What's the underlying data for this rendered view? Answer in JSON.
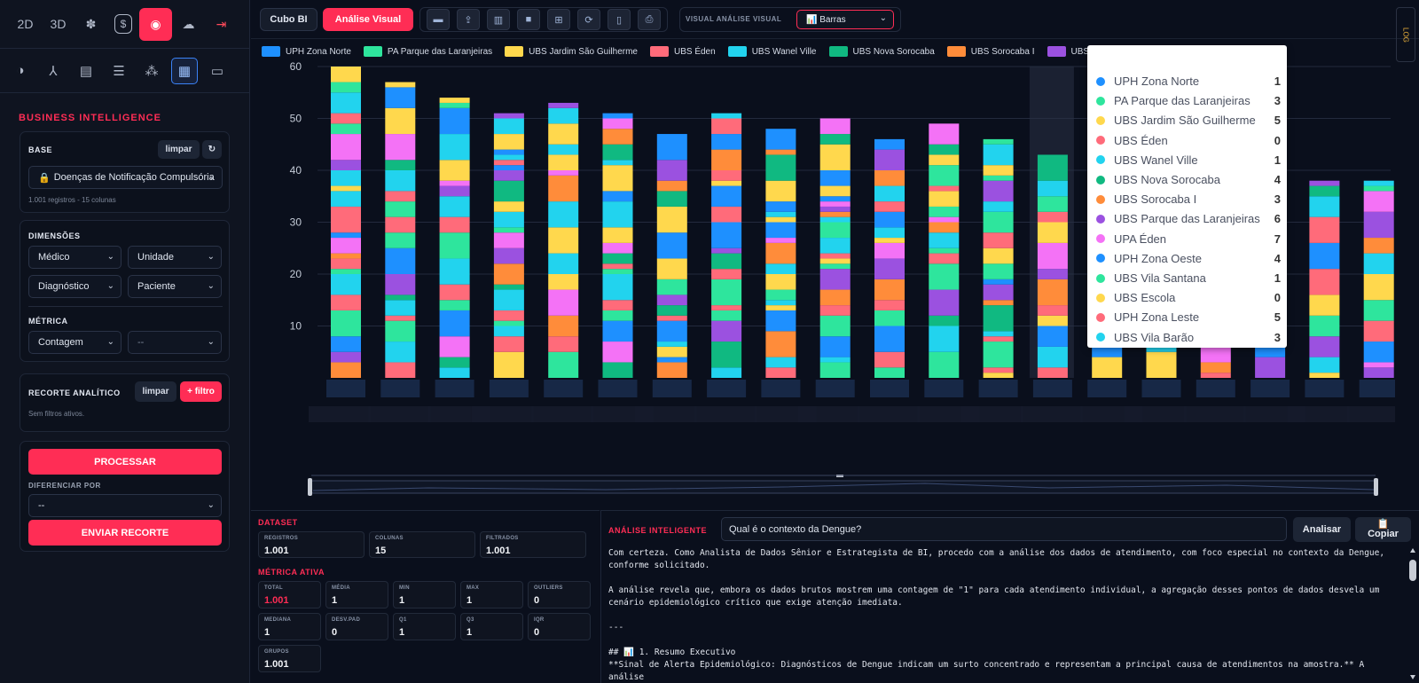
{
  "sidebar": {
    "top_icons": [
      {
        "name": "2d-button",
        "label": "2D"
      },
      {
        "name": "3d-button",
        "label": "3D"
      },
      {
        "name": "virus-icon",
        "label": "✽"
      },
      {
        "name": "finance-icon",
        "label": "$"
      },
      {
        "name": "brain-icon",
        "label": "◉"
      },
      {
        "name": "cloud-icon",
        "label": "☁"
      },
      {
        "name": "logout-icon",
        "label": "⇥"
      }
    ],
    "section_icons": [
      "globe-icon",
      "tree-icon",
      "file-chart-icon",
      "database-icon",
      "network-icon",
      "dashboard-icon",
      "document-icon"
    ],
    "title": "BUSINESS INTELLIGENCE",
    "base": {
      "label": "BASE",
      "clear": "limpar",
      "refresh": "↻",
      "selected": "Doenças de Notificação Compulsória",
      "info": "1.001 registros - 15 colunas"
    },
    "dimensions": {
      "label": "DIMENSÕES",
      "d1": "Médico",
      "d2": "Unidade",
      "d3": "Diagnóstico",
      "d4": "Paciente"
    },
    "metric": {
      "label": "MÉTRICA",
      "m1": "Contagem",
      "m2": "--"
    },
    "filter": {
      "label": "RECORTE ANALÍTICO",
      "clear": "limpar",
      "add": "+ filtro",
      "empty": "Sem filtros ativos."
    },
    "process": "PROCESSAR",
    "diff_label": "DIFERENCIAR POR",
    "diff_value": "--",
    "send": "ENVIAR RECORTE"
  },
  "toolbar": {
    "tab1": "Cubo BI",
    "tab2": "Análise Visual",
    "visual_label": "VISUAL ANÁLISE VISUAL",
    "visual_value": "📊 Barras",
    "side_tab": "LOG"
  },
  "legend": [
    {
      "name": "UPH Zona Norte",
      "color": "#1e90ff"
    },
    {
      "name": "PA Parque das Laranjeiras",
      "color": "#2ee59d"
    },
    {
      "name": "UBS Jardim São Guilherme",
      "color": "#ffd84d"
    },
    {
      "name": "UBS Éden",
      "color": "#ff6b7a"
    },
    {
      "name": "UBS Wanel Ville",
      "color": "#22d3ee"
    },
    {
      "name": "UBS Nova Sorocaba",
      "color": "#10b981"
    },
    {
      "name": "UBS Sorocaba I",
      "color": "#ff8c3a"
    },
    {
      "name": "UBS Parque d",
      "color": "#9b51e0"
    }
  ],
  "colors": {
    "accent": "#ff2d55",
    "palette": [
      "#1e90ff",
      "#2ee59d",
      "#ffd84d",
      "#ff6b7a",
      "#22d3ee",
      "#10b981",
      "#ff8c3a",
      "#9b51e0",
      "#f472f6",
      "#1e90ff",
      "#2ee59d",
      "#ffd84d",
      "#ff6b7a",
      "#22d3ee"
    ]
  },
  "chart_data": {
    "type": "bar",
    "stacked": true,
    "y_ticks": [
      10,
      20,
      30,
      40,
      50,
      60
    ],
    "ylim": [
      0,
      60
    ],
    "totals": [
      60,
      57,
      54,
      51,
      53,
      51,
      47,
      51,
      48,
      50,
      46,
      49,
      46,
      43,
      42,
      41,
      40,
      39,
      38,
      38
    ],
    "highlighted_index": 13
  },
  "tooltip": [
    {
      "name": "UPH Zona Norte",
      "value": "1",
      "color": "#1e90ff"
    },
    {
      "name": "PA Parque das Laranjeiras",
      "value": "3",
      "color": "#2ee59d"
    },
    {
      "name": "UBS Jardim São Guilherme",
      "value": "5",
      "color": "#ffd84d"
    },
    {
      "name": "UBS Éden",
      "value": "0",
      "color": "#ff6b7a"
    },
    {
      "name": "UBS Wanel Ville",
      "value": "1",
      "color": "#22d3ee"
    },
    {
      "name": "UBS Nova Sorocaba",
      "value": "4",
      "color": "#10b981"
    },
    {
      "name": "UBS Sorocaba I",
      "value": "3",
      "color": "#ff8c3a"
    },
    {
      "name": "UBS Parque das Laranjeiras",
      "value": "6",
      "color": "#9b51e0"
    },
    {
      "name": "UPA Éden",
      "value": "7",
      "color": "#f472f6"
    },
    {
      "name": "UPH Zona Oeste",
      "value": "4",
      "color": "#1e90ff"
    },
    {
      "name": "UBS Vila Santana",
      "value": "1",
      "color": "#2ee59d"
    },
    {
      "name": "UBS Escola",
      "value": "0",
      "color": "#ffd84d"
    },
    {
      "name": "UPH Zona Leste",
      "value": "5",
      "color": "#ff6b7a"
    },
    {
      "name": "UBS Vila Barão",
      "value": "3",
      "color": "#22d3ee"
    }
  ],
  "dataset": {
    "title": "DATASET",
    "registros_k": "REGISTROS",
    "registros": "1.001",
    "colunas_k": "COLUNAS",
    "colunas": "15",
    "filtrados_k": "FILTRADOS",
    "filtrados": "1.001"
  },
  "metric_active": {
    "title": "MÉTRICA ATIVA",
    "total_k": "TOTAL",
    "total": "1.001",
    "media_k": "MÉDIA",
    "media": "1",
    "min_k": "MIN",
    "min": "1",
    "max_k": "MAX",
    "max": "1",
    "outliers_k": "OUTLIERS",
    "outliers": "0",
    "mediana_k": "MEDIANA",
    "mediana": "1",
    "desv_k": "DESV.PAD",
    "desv": "0",
    "q1_k": "Q1",
    "q1": "1",
    "q3_k": "Q3",
    "q3": "1",
    "iqr_k": "IQR",
    "iqr": "0",
    "grupos_k": "GRUPOS",
    "grupos": "1.001"
  },
  "ai": {
    "title": "ANÁLISE INTELIGENTE",
    "question": "Qual é o contexto da Dengue?",
    "analyze": "Analisar",
    "copy_icon": "📋",
    "copy": "Copiar",
    "p1": "Com certeza. Como Analista de Dados Sênior e Estrategista de BI, procedo com a análise dos dados de atendimento, com foco especial no contexto da Dengue, conforme solicitado.",
    "p2": "A análise revela que, embora os dados brutos mostrem uma contagem de \"1\" para cada atendimento individual, a agregação desses pontos de dados desvela um cenário epidemiológico crítico que exige atenção imediata.",
    "p3": "---",
    "p4": "## 📊 1. Resumo Executivo",
    "p5": "**Sinal de Alerta Epidemiológico: Diagnósticos de Dengue indicam um surto concentrado e representam a principal causa de atendimentos na amostra.** A análise"
  }
}
